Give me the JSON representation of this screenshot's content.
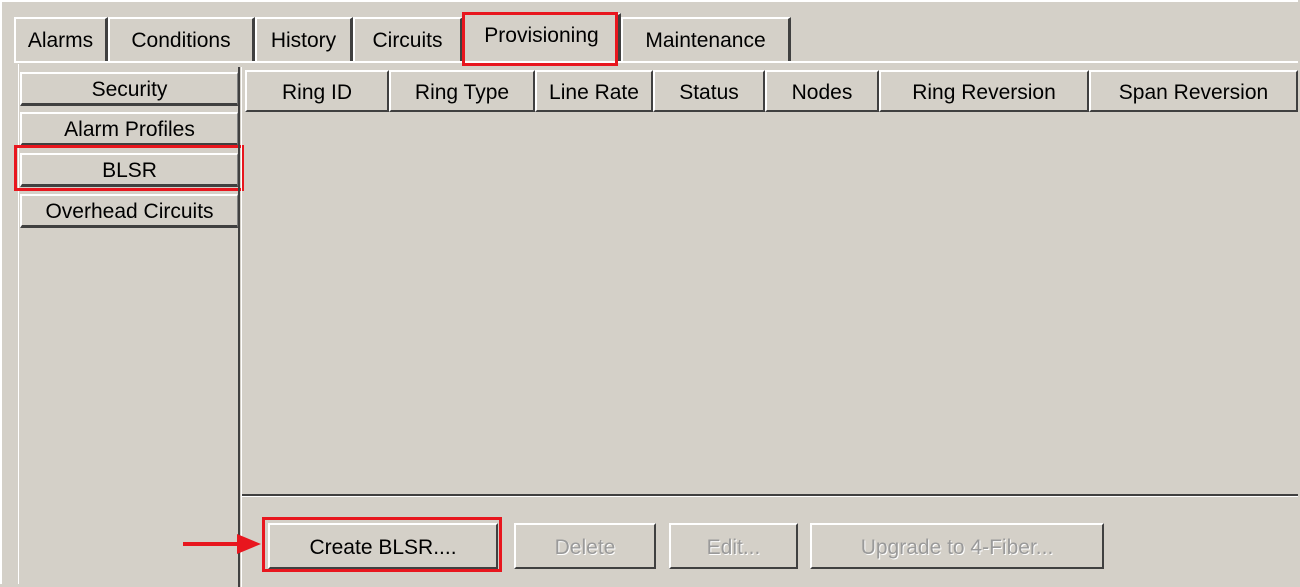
{
  "tabs": [
    {
      "label": "Alarms",
      "selected": false
    },
    {
      "label": "Conditions",
      "selected": false
    },
    {
      "label": "History",
      "selected": false
    },
    {
      "label": "Circuits",
      "selected": false
    },
    {
      "label": "Provisioning",
      "selected": true
    },
    {
      "label": "Maintenance",
      "selected": false
    }
  ],
  "subtabs": [
    {
      "label": "Security",
      "selected": false
    },
    {
      "label": "Alarm Profiles",
      "selected": false
    },
    {
      "label": "BLSR",
      "selected": true
    },
    {
      "label": "Overhead Circuits",
      "selected": false
    }
  ],
  "table": {
    "columns": [
      "Ring ID",
      "Ring Type",
      "Line Rate",
      "Status",
      "Nodes",
      "Ring Reversion",
      "Span Reversion"
    ],
    "rows": []
  },
  "buttons": {
    "create": "Create BLSR....",
    "delete": "Delete",
    "edit": "Edit...",
    "upgrade": "Upgrade to 4-Fiber..."
  },
  "colors": {
    "background": "#d4d0c8",
    "highlight": "#e8161e",
    "disabled_text": "#9a9a9a"
  }
}
